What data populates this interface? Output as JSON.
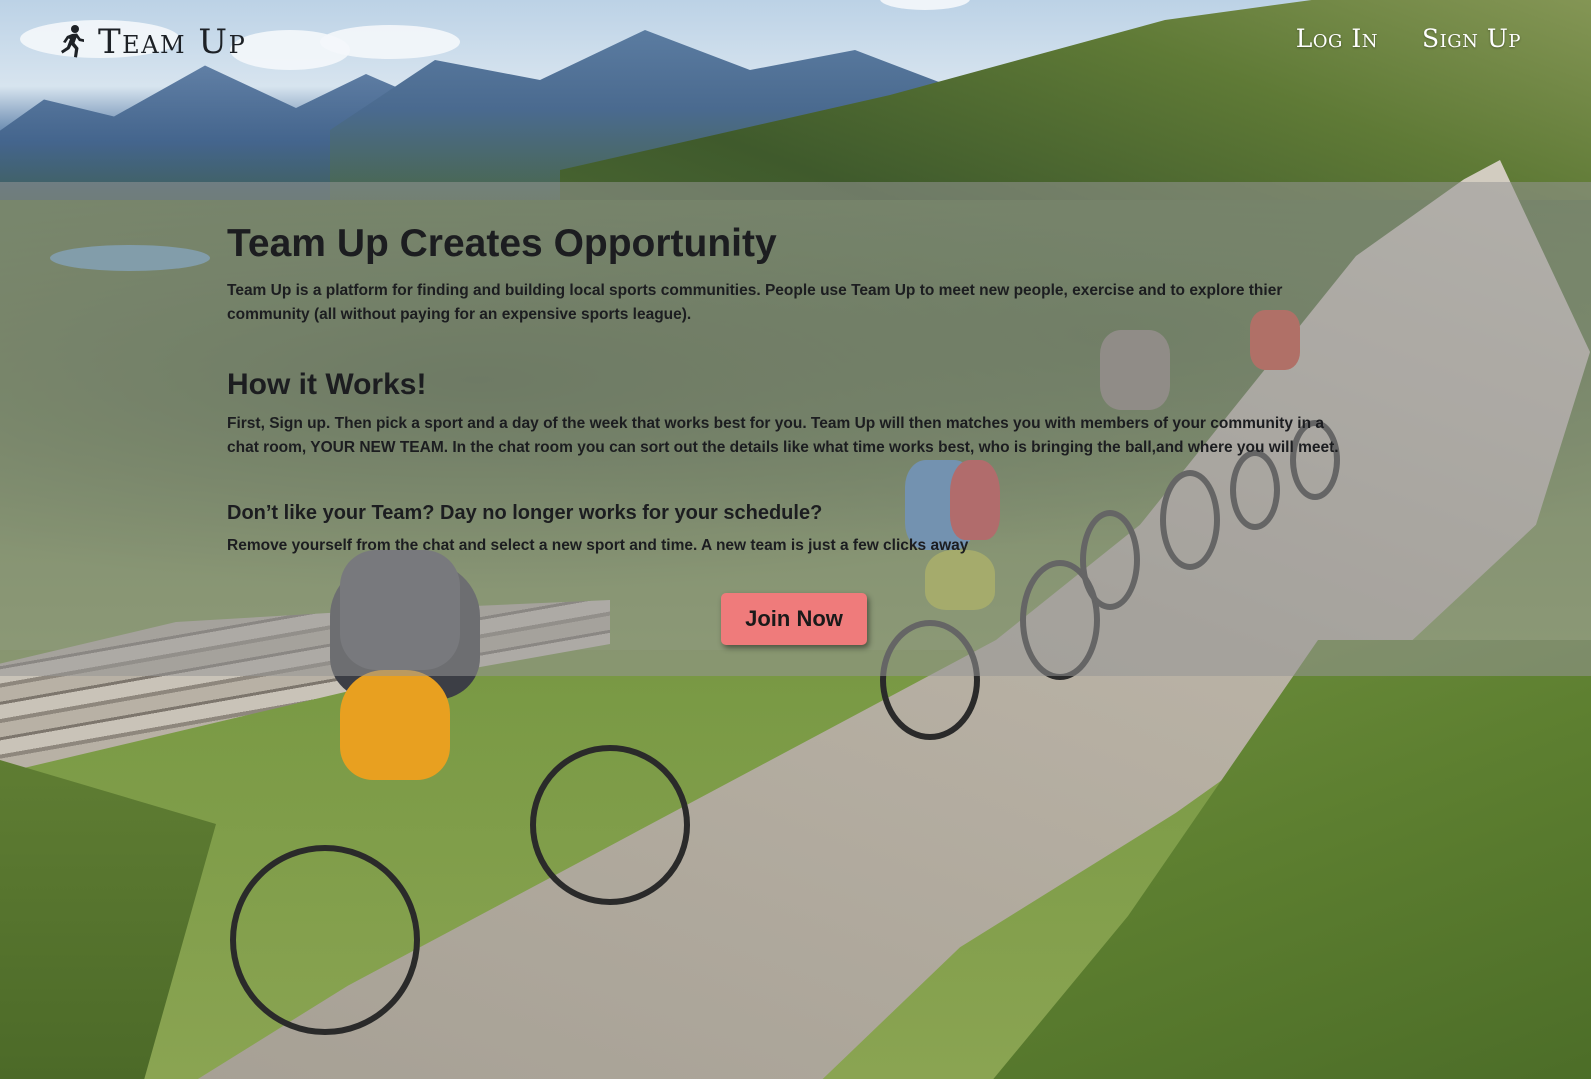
{
  "header": {
    "brand": "Team Up",
    "brand_icon": "running-person-icon",
    "nav": {
      "login": "Log In",
      "signup": "Sign Up"
    }
  },
  "main": {
    "title": "Team Up Creates Opportunity",
    "intro": "Team Up is a platform for finding and building local sports communities. People use Team Up to meet new people, exercise and to explore thier community (all without paying for an expensive sports league).",
    "how_heading": "How it Works!",
    "how_text": "First, Sign up. Then pick a sport and a day of the week that works best for you. Team Up will then matches you with members of your community in a chat room, YOUR NEW TEAM. In the chat room you can sort out the details like what time works best, who is bringing the ball,and where you will meet.",
    "dislike_heading": "Don’t like your Team? Day no longer works for your schedule?",
    "dislike_text": "Remove yourself from the chat and select a new sport and time. A new team is just a few clicks away",
    "cta": "Join Now"
  },
  "colors": {
    "cta_background": "#ef7b7b",
    "band_overlay": "rgba(150,150,150,0.55)",
    "nav_text": "#ffffff",
    "body_text": "#1c1d20"
  }
}
